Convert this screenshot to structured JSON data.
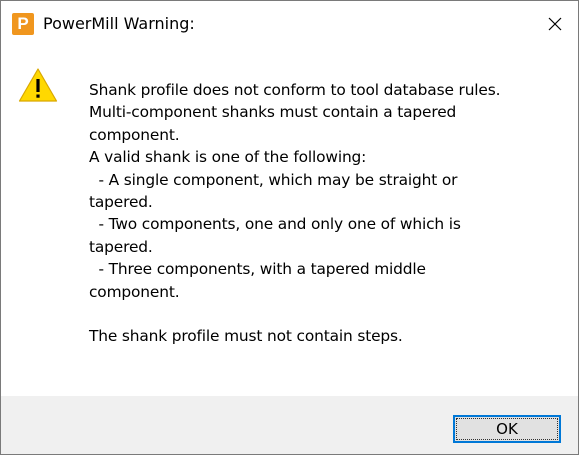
{
  "window": {
    "title": "PowerMill Warning:",
    "app_icon_letter": "P",
    "app_icon_color": "#f0961e",
    "close_icon": "close-icon"
  },
  "message": {
    "icon": "warning-icon",
    "icon_color": "#ffd800",
    "lines": [
      "Shank profile does not conform to tool database rules.",
      "Multi-component shanks must contain a tapered",
      "component.",
      "A valid shank is one of the following:",
      "  - A single component, which may be straight or",
      "tapered.",
      "  - Two components, one and only one of which is",
      "tapered.",
      "  - Three components, with a tapered middle",
      "component.",
      "",
      "The shank profile must not contain steps."
    ]
  },
  "buttons": {
    "ok_label": "OK",
    "ok_focus_color": "#0078d7"
  }
}
